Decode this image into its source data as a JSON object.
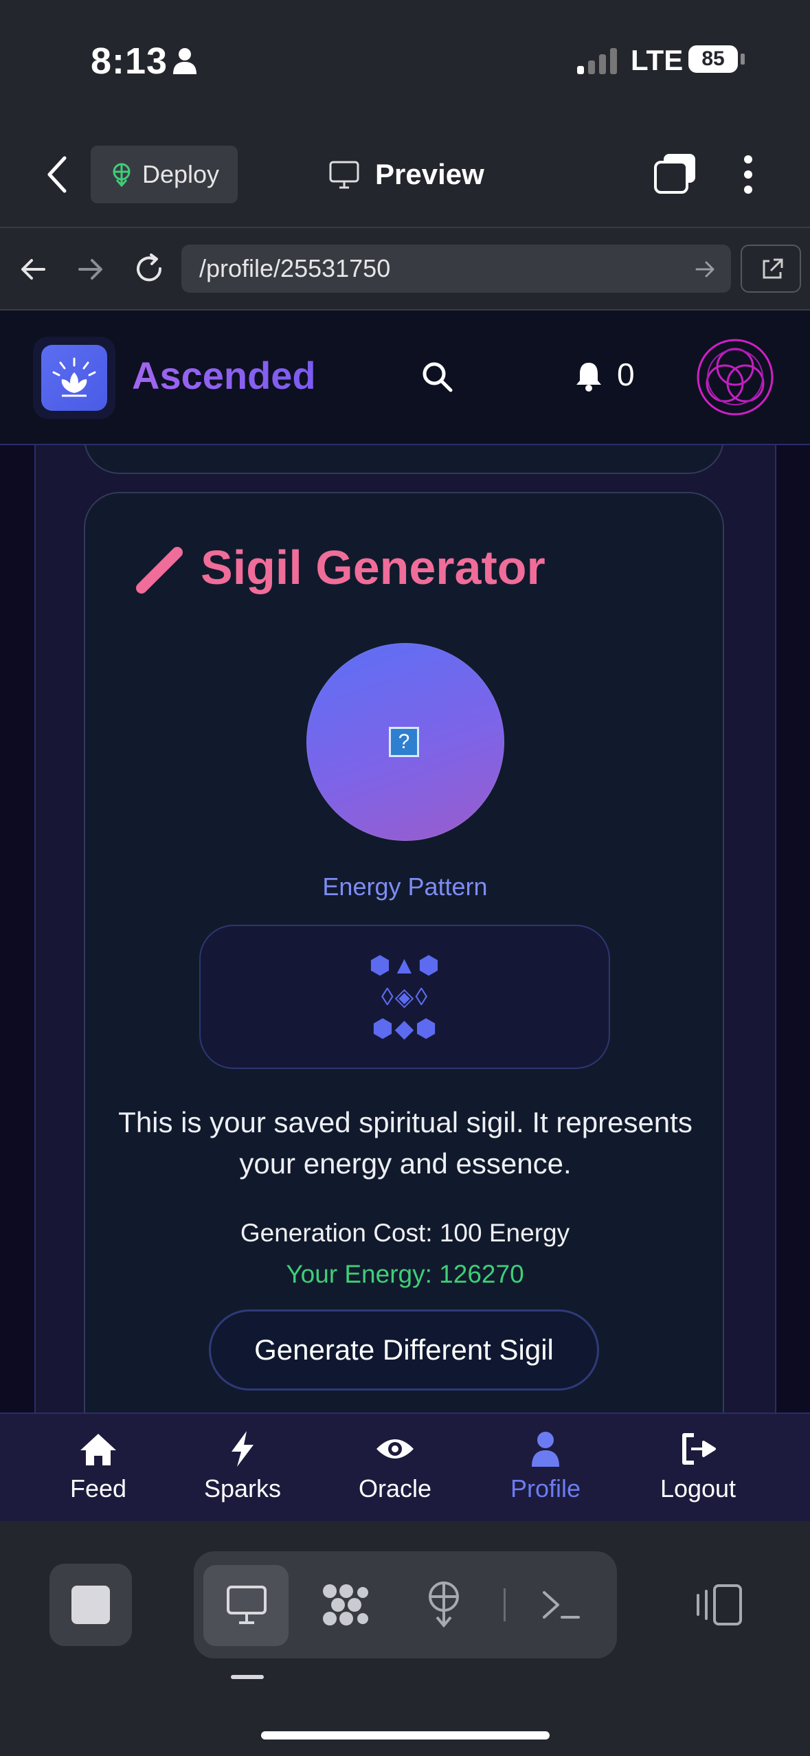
{
  "status_bar": {
    "time": "8:13",
    "network": "LTE",
    "battery": "85"
  },
  "toolbar": {
    "deploy_label": "Deploy",
    "preview_label": "Preview"
  },
  "url_bar": {
    "url": "/profile/25531750"
  },
  "app_header": {
    "brand": "Ascended",
    "notification_count": "0"
  },
  "sigil_card": {
    "title": "Sigil Generator",
    "placeholder_glyph": "?",
    "pattern_label": "Energy Pattern",
    "pattern_rows": [
      "⬢▲⬢",
      "◊◈◊",
      "⬢◆⬢"
    ],
    "description": "This is your saved spiritual sigil. It represents your energy and essence.",
    "cost": "Generation Cost: 100 Energy",
    "energy": "Your Energy: 126270",
    "generate_button": "Generate Different Sigil"
  },
  "bottom_nav": {
    "items": [
      {
        "label": "Feed",
        "icon": "home-icon"
      },
      {
        "label": "Sparks",
        "icon": "bolt-icon"
      },
      {
        "label": "Oracle",
        "icon": "eye-icon"
      },
      {
        "label": "Profile",
        "icon": "user-icon",
        "active": true
      },
      {
        "label": "Logout",
        "icon": "logout-icon"
      }
    ]
  },
  "colors": {
    "title_pink": "#f06d9a",
    "energy_green": "#3fce78",
    "accent_indigo": "#6b7cf3",
    "card_bg": "#111a2c"
  }
}
